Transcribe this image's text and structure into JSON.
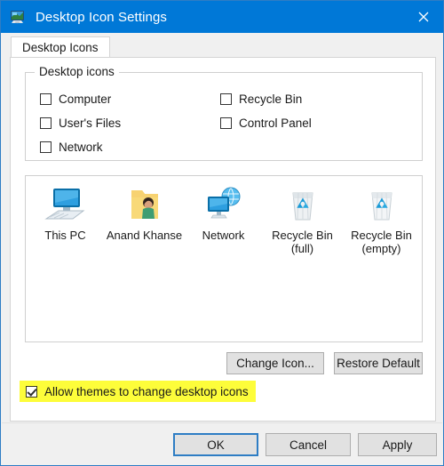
{
  "window": {
    "title": "Desktop Icon Settings",
    "icon": "display-monitor-icon",
    "close_label": "✕",
    "accent_color": "#0078d7",
    "border_color": "#2e7dc4"
  },
  "tabs": [
    {
      "label": "Desktop Icons",
      "selected": true
    }
  ],
  "groupbox": {
    "legend": "Desktop icons",
    "checkboxes": [
      {
        "label": "Computer",
        "checked": false,
        "column": "left",
        "row": 0
      },
      {
        "label": "User's Files",
        "checked": false,
        "column": "left",
        "row": 1
      },
      {
        "label": "Network",
        "checked": false,
        "column": "left",
        "row": 2
      },
      {
        "label": "Recycle Bin",
        "checked": false,
        "column": "right",
        "row": 0
      },
      {
        "label": "Control Panel",
        "checked": false,
        "column": "right",
        "row": 1
      }
    ]
  },
  "icon_preview": {
    "items": [
      {
        "caption": "This PC",
        "icon": "this-pc-icon"
      },
      {
        "caption": "Anand Khanse",
        "icon": "user-folder-icon"
      },
      {
        "caption": "Network",
        "icon": "network-icon"
      },
      {
        "caption": "Recycle Bin\n(full)",
        "icon": "recycle-bin-full-icon"
      },
      {
        "caption": "Recycle Bin\n(empty)",
        "icon": "recycle-bin-empty-icon"
      }
    ]
  },
  "icon_actions": {
    "change_icon_label": "Change Icon...",
    "restore_default_label": "Restore Default"
  },
  "allow_themes": {
    "label": "Allow themes to change desktop icons",
    "checked": true,
    "highlight_color": "#fdfd3a"
  },
  "footer": {
    "ok_label": "OK",
    "cancel_label": "Cancel",
    "apply_label": "Apply"
  }
}
